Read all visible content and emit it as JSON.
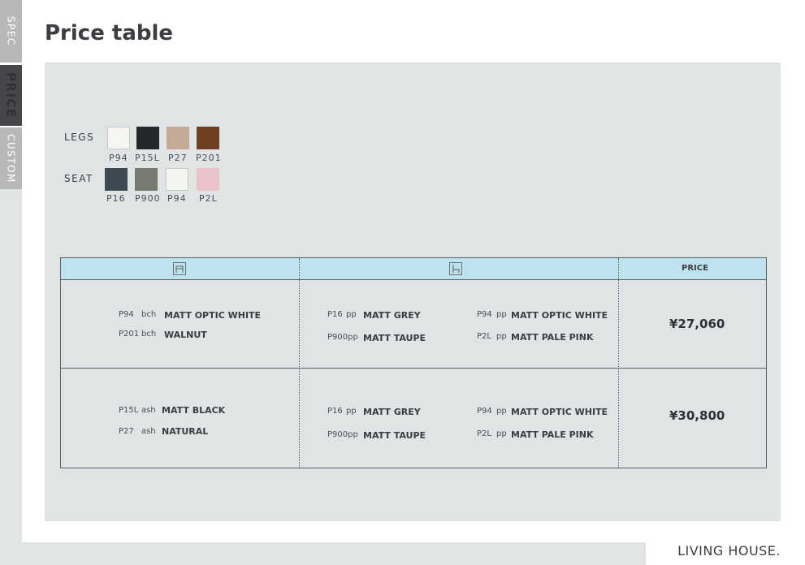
{
  "tabs": [
    {
      "label": "SPEC"
    },
    {
      "label": "PRICE"
    },
    {
      "label": "CUSTOM"
    }
  ],
  "page_title": "Price table",
  "legs": {
    "label": "LEGS",
    "swatches": [
      {
        "code": "P94",
        "color": "#f7f6f1"
      },
      {
        "code": "P15L",
        "color": "#24272b"
      },
      {
        "code": "P27",
        "color": "#c3aa96"
      },
      {
        "code": "P201",
        "color": "#6e4021"
      }
    ]
  },
  "seat": {
    "label": "SEAT",
    "swatches": [
      {
        "code": "P16",
        "color": "#3d4a52"
      },
      {
        "code": "P900",
        "color": "#767a70"
      },
      {
        "code": "P94",
        "color": "#f5f5f0"
      },
      {
        "code": "P2L",
        "color": "#ebc3cc"
      }
    ]
  },
  "table": {
    "header": {
      "price_label": "PRICE",
      "leg_icon": "stool-front-icon",
      "seat_icon": "chair-side-icon"
    },
    "rows": [
      {
        "legs": [
          {
            "code": "P94",
            "type": "bch",
            "name": "MATT OPTIC WHITE"
          },
          {
            "code": "P201",
            "type": "bch",
            "name": "WALNUT"
          }
        ],
        "seats_a": [
          {
            "code": "P16",
            "type": "pp",
            "name": "MATT GREY"
          },
          {
            "code": "P900pp",
            "type": "",
            "name": "MATT TAUPE"
          }
        ],
        "seats_b": [
          {
            "code": "P94",
            "type": "pp",
            "name": "MATT OPTIC WHITE"
          },
          {
            "code": "P2L",
            "type": "pp",
            "name": "MATT PALE PINK"
          }
        ],
        "price": "¥27,060"
      },
      {
        "legs": [
          {
            "code": "P15L",
            "type": "ash",
            "name": "MATT BLACK"
          },
          {
            "code": "P27",
            "type": "ash",
            "name": "NATURAL"
          }
        ],
        "seats_a": [
          {
            "code": "P16",
            "type": "pp",
            "name": "MATT GREY"
          },
          {
            "code": "P900pp",
            "type": "",
            "name": "MATT TAUPE"
          }
        ],
        "seats_b": [
          {
            "code": "P94",
            "type": "pp",
            "name": "MATT OPTIC WHITE"
          },
          {
            "code": "P2L",
            "type": "pp",
            "name": "MATT PALE PINK"
          }
        ],
        "price": "¥30,800"
      }
    ]
  },
  "brand": "LIVING HOUSE."
}
